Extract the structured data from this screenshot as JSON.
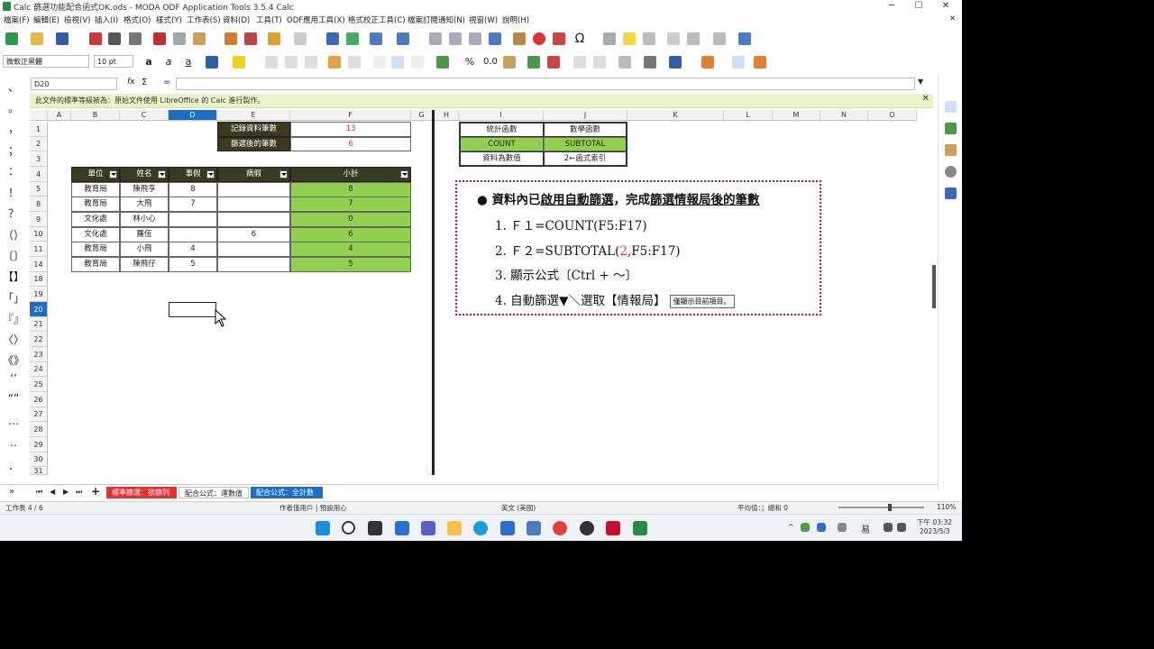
{
  "window": {
    "title": "Calc 篩選功能配合函式OK.ods - MODA ODF Application Tools 3.5.4 Calc",
    "minimize": "─",
    "maximize": "☐",
    "close": "✕",
    "doc_close": "✕"
  },
  "menu": [
    "檔案(F)",
    "編輯(E)",
    "檢視(V)",
    "插入(I)",
    "格式(O)",
    "樣式(Y)",
    "工作表(S)",
    "資料(D)",
    "工具(T)",
    "ODF應用工具(X)",
    "格式校正工具(C)",
    "檔案訂閱通知(N)",
    "視窗(W)",
    "說明(H)"
  ],
  "format_bar": {
    "font_name": "微軟正黑體",
    "font_size": "10 pt"
  },
  "formula_bar": {
    "name_box": "D20",
    "sigma": "Σ",
    "equals": "=",
    "fx": "fx"
  },
  "infobar": {
    "message": "此文件的標準等級被為：原始文件使用 LibreOffice 的 Calc 進行製作。",
    "close": "✕"
  },
  "left_symbols": [
    "、",
    "。",
    "，",
    "；",
    "：",
    "！",
    "？",
    "（）",
    "〔〕",
    "【】",
    "「」",
    "『』",
    "〈〉",
    "《》",
    "‘’",
    "“”",
    "…",
    "‥",
    "．"
  ],
  "columns": [
    "A",
    "B",
    "C",
    "D",
    "E",
    "F",
    "G",
    "H",
    "I",
    "J",
    "K",
    "L",
    "M",
    "N",
    "O"
  ],
  "rows": [
    "1",
    "2",
    "3",
    "4",
    "5",
    "8",
    "9",
    "10",
    "11",
    "14",
    "18",
    "19",
    "20",
    "21",
    "22",
    "23",
    "24",
    "25",
    "26",
    "27",
    "28",
    "29",
    "30",
    "31"
  ],
  "summary": {
    "label1": "記錄資料筆數",
    "value1": "13",
    "label2": "篩選後的筆數",
    "value2": "6"
  },
  "table": {
    "headers": [
      "單位",
      "姓名",
      "事假",
      "病假",
      "小計"
    ],
    "rows": [
      [
        "教育局",
        "陳飛亨",
        "8",
        "",
        "8"
      ],
      [
        "教育局",
        "大飛",
        "7",
        "",
        "7"
      ],
      [
        "文化處",
        "林小心",
        "",
        "",
        "0"
      ],
      [
        "文化處",
        "羅伍",
        "",
        "6",
        "6"
      ],
      [
        "教育局",
        "小飛",
        "4",
        "",
        "4"
      ],
      [
        "教育局",
        "陳飛仔",
        "5",
        "",
        "5"
      ]
    ]
  },
  "ref_table": {
    "h1": "統計函數",
    "h2": "數學函數",
    "r1c1": "COUNT",
    "r1c2": "SUBTOTAL",
    "r2c1": "資料為數值",
    "r2c2": "2←函式索引"
  },
  "note": {
    "bullet": "●",
    "heading_a": "資料內已",
    "heading_b": "啟用自動篩選",
    "heading_c": "，完成",
    "heading_d": "篩選情報局後的筆數",
    "item1": "1.   Ｆ１=COUNT(F5:F17)",
    "item2_a": "2.   Ｆ２=SUBTOTAL(",
    "item2_b": "2",
    "item2_c": ",F5:F17)",
    "item3": "3.   顯示公式〔Ctrl + ～〕",
    "item4": "4.   自動篩選▼＼選取【情報局】",
    "item4_badge": "僅顯示目前項目。"
  },
  "sheet_tabs": [
    {
      "label": "標準篩選：欲篩列",
      "color": "#e03030",
      "text": "#fff"
    },
    {
      "label": "配合公式：運數值",
      "color": "#ffffff",
      "text": "#222"
    },
    {
      "label": "配合公式：全計數",
      "color": "#1a6fc4",
      "text": "#fff"
    }
  ],
  "sheet_nav": [
    "⏮",
    "◀",
    "▶",
    "⏭",
    "+"
  ],
  "status": {
    "sheet": "工作表 4 / 6",
    "style": "作者僅用戶 | 預設用心",
    "lang": "英文 (美國)",
    "sum": "平均值：；總和 0",
    "zoom": "110%"
  },
  "taskbar": {
    "time": "下午 03:32",
    "date": "2023/5/3",
    "ime": "易"
  },
  "colors": {
    "accent": "#1a6fc4",
    "green": "#92d050",
    "dark_header": "#3b3a1e",
    "red_text": "#e03030",
    "note_border": "#c8102e"
  }
}
